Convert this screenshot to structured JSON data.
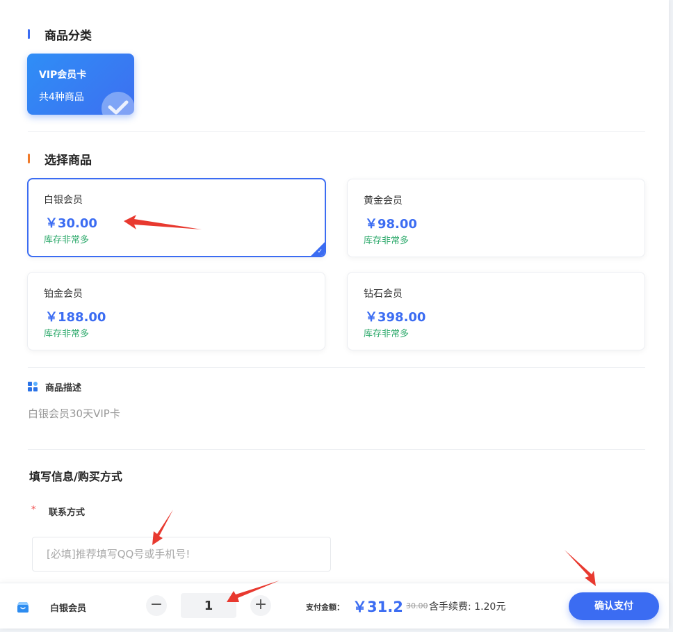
{
  "category_section": {
    "title": "商品分类",
    "accent": "#3b6cf2",
    "cards": [
      {
        "name": "VIP会员卡",
        "count": "共4种商品",
        "selected": true
      }
    ]
  },
  "product_section": {
    "title": "选择商品",
    "accent": "#f07a2a",
    "items": [
      {
        "name": "白银会员",
        "price": "￥30.00",
        "stock": "库存非常多",
        "selected": true
      },
      {
        "name": "黄金会员",
        "price": "￥98.00",
        "stock": "库存非常多",
        "selected": false
      },
      {
        "name": "铂金会员",
        "price": "￥188.00",
        "stock": "库存非常多",
        "selected": false
      },
      {
        "name": "钻石会员",
        "price": "￥398.00",
        "stock": "库存非常多",
        "selected": false
      }
    ]
  },
  "description": {
    "title": "商品描述",
    "text": "白银会员30天VIP卡"
  },
  "form": {
    "title": "填写信息/购买方式",
    "required_mark": "*",
    "contact_label": "联系方式",
    "contact_placeholder": "[必填]推荐填写QQ号或手机号!",
    "contact_value": ""
  },
  "bottom_bar": {
    "product_name": "白银会员",
    "minus": "−",
    "plus": "+",
    "quantity": "1",
    "pay_label": "支付金额：",
    "pay_amount": "￥31.2",
    "original_price": "30.00",
    "fee_text": "含手续费: 1.20元",
    "confirm_label": "确认支付"
  },
  "colors": {
    "primary": "#3b6cf2",
    "stock_green": "#2eaa6c",
    "annotation_red": "#e8392f"
  }
}
